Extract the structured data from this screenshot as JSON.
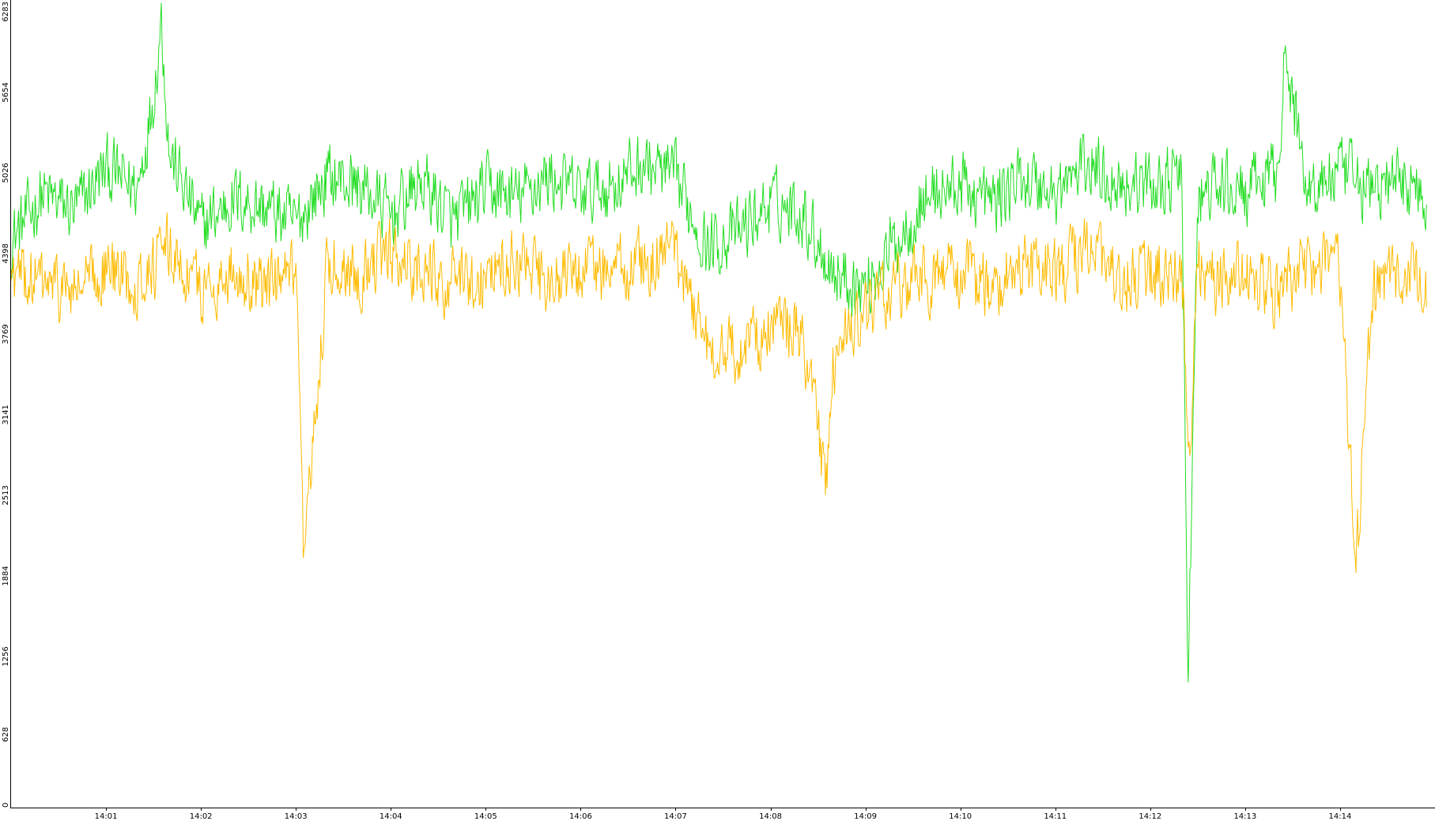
{
  "chart_data": {
    "type": "line",
    "title": "",
    "xlabel": "",
    "ylabel": "",
    "grid": false,
    "legend": "none",
    "ylim": [
      0,
      6283
    ],
    "xlim": [
      "14:00:00",
      "14:15:00"
    ],
    "y_ticks": [
      "0",
      "628",
      "1256",
      "1884",
      "2513",
      "3141",
      "3769",
      "4398",
      "5026",
      "5654",
      "6283"
    ],
    "x_ticks": [
      "14:01",
      "14:02",
      "14:03",
      "14:04",
      "14:05",
      "14:06",
      "14:07",
      "14:08",
      "14:09",
      "14:10",
      "14:11",
      "14:12",
      "14:13",
      "14:14"
    ],
    "series": [
      {
        "color": "#22dd22",
        "x": [
          "14:00:00",
          "14:00:20",
          "14:00:40",
          "14:01:00",
          "14:01:20",
          "14:01:30",
          "14:01:35",
          "14:01:40",
          "14:02:00",
          "14:02:20",
          "14:02:40",
          "14:03:00",
          "14:03:20",
          "14:03:40",
          "14:04:00",
          "14:04:20",
          "14:04:40",
          "14:05:00",
          "14:05:20",
          "14:05:40",
          "14:06:00",
          "14:06:20",
          "14:06:40",
          "14:07:00",
          "14:07:20",
          "14:07:40",
          "14:08:00",
          "14:08:20",
          "14:08:40",
          "14:09:00",
          "14:09:20",
          "14:09:40",
          "14:10:00",
          "14:10:20",
          "14:10:40",
          "14:11:00",
          "14:11:20",
          "14:11:40",
          "14:12:00",
          "14:12:20",
          "14:12:24",
          "14:12:30",
          "14:12:40",
          "14:13:00",
          "14:13:20",
          "14:13:25",
          "14:13:30",
          "14:13:40",
          "14:14:00",
          "14:14:20",
          "14:14:40",
          "14:14:55"
        ],
        "y": [
          4420,
          4780,
          4650,
          4980,
          4820,
          5550,
          6150,
          5100,
          4520,
          4750,
          4680,
          4550,
          4920,
          4850,
          4620,
          4880,
          4560,
          4820,
          4750,
          4920,
          4780,
          4850,
          5020,
          4900,
          4380,
          4480,
          4720,
          4650,
          4180,
          4050,
          4420,
          4780,
          4850,
          4720,
          4920,
          4780,
          5020,
          4880,
          4850,
          4920,
          1000,
          4700,
          4850,
          4780,
          4950,
          5800,
          5500,
          4820,
          4950,
          4820,
          4900,
          4780
        ]
      },
      {
        "color": "#ffbb00",
        "x": [
          "14:00:00",
          "14:00:20",
          "14:00:40",
          "14:01:00",
          "14:01:20",
          "14:01:40",
          "14:02:00",
          "14:02:20",
          "14:02:40",
          "14:03:00",
          "14:03:05",
          "14:03:20",
          "14:03:40",
          "14:04:00",
          "14:04:20",
          "14:04:40",
          "14:05:00",
          "14:05:20",
          "14:05:40",
          "14:06:00",
          "14:06:20",
          "14:06:40",
          "14:07:00",
          "14:07:20",
          "14:07:40",
          "14:08:00",
          "14:08:20",
          "14:08:35",
          "14:08:40",
          "14:09:00",
          "14:09:20",
          "14:09:40",
          "14:10:00",
          "14:10:20",
          "14:10:40",
          "14:11:00",
          "14:11:20",
          "14:11:40",
          "14:12:00",
          "14:12:20",
          "14:12:25",
          "14:12:30",
          "14:12:40",
          "14:13:00",
          "14:13:20",
          "14:13:40",
          "14:14:00",
          "14:14:10",
          "14:14:20",
          "14:14:40",
          "14:14:55"
        ],
        "y": [
          4150,
          4080,
          4020,
          4200,
          4100,
          4350,
          4020,
          4180,
          4050,
          4120,
          1850,
          4250,
          4180,
          4320,
          4180,
          4080,
          4150,
          4280,
          4050,
          4200,
          4180,
          4250,
          4320,
          3620,
          3550,
          3750,
          3700,
          2500,
          3500,
          3850,
          4050,
          4120,
          4180,
          4050,
          4220,
          4150,
          4350,
          4080,
          4200,
          4120,
          2700,
          4250,
          4100,
          4150,
          4000,
          4250,
          4200,
          1800,
          4000,
          4180,
          4100
        ]
      }
    ]
  }
}
